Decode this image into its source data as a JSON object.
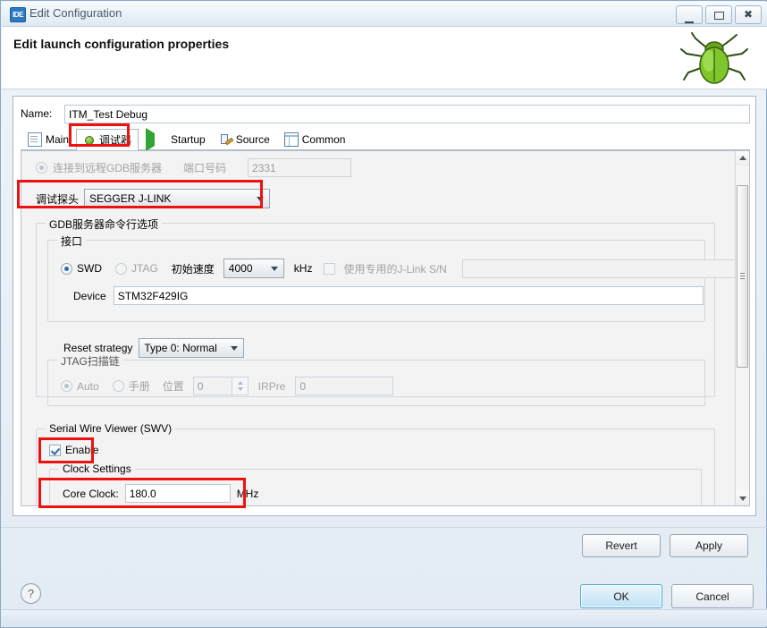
{
  "window": {
    "title": "Edit Configuration",
    "app_icon_text": "IDE",
    "minimize_label": "Minimize",
    "maximize_label": "Maximize",
    "close_label": "Close"
  },
  "header": {
    "heading": "Edit launch configuration properties",
    "icon": "green-bug-icon"
  },
  "name_field": {
    "label": "Name:",
    "value": "ITM_Test Debug"
  },
  "tabs": [
    {
      "label": "Main",
      "icon": "document-icon",
      "selected": false
    },
    {
      "label": "调试器",
      "icon": "bug-icon",
      "selected": true
    },
    {
      "label": "Startup",
      "icon": "play-icon",
      "selected": false
    },
    {
      "label": "Source",
      "icon": "source-icon",
      "selected": false
    },
    {
      "label": "Common",
      "icon": "table-icon",
      "selected": false
    }
  ],
  "debugger_tab": {
    "remote_gdb": {
      "radio_label": "连接到远程GDB服务器",
      "checked": false,
      "port_label": "端口号码",
      "port_value": "2331"
    },
    "probe": {
      "label": "调试探头",
      "value": "SEGGER J-LINK"
    },
    "gdb_server_group": {
      "caption": "GDB服务器命令行选项",
      "interface_group": {
        "caption": "接口",
        "swd_label": "SWD",
        "swd_selected": true,
        "jtag_label": "JTAG",
        "jtag_selected": false,
        "speed_label": "初始速度",
        "speed_value": "4000",
        "speed_unit": "kHz",
        "use_sn_label": "使用专用的J-Link S/N",
        "use_sn_checked": false,
        "sn_value": "",
        "device_label": "Device",
        "device_value": "STM32F429IG"
      },
      "reset_strategy_label": "Reset strategy",
      "reset_strategy_value": "Type 0: Normal",
      "jtag_scan_group": {
        "caption": "JTAG扫描链",
        "auto_label": "Auto",
        "auto_selected": true,
        "manual_label": "手册",
        "manual_selected": false,
        "position_label": "位置",
        "position_value": "0",
        "irpre_label": "IRPre",
        "irpre_value": "0"
      }
    },
    "swv_group": {
      "caption": "Serial Wire Viewer (SWV)",
      "enable_label": "Enable",
      "enable_checked": true,
      "clock_settings": {
        "caption": "Clock Settings",
        "core_clock_label": "Core Clock:",
        "core_clock_value": "180.0",
        "core_clock_unit": "MHz"
      }
    }
  },
  "buttons": {
    "revert": "Revert",
    "apply": "Apply",
    "ok": "OK",
    "cancel": "Cancel",
    "help": "?"
  },
  "highlights": {
    "accent_color": "#ee1111",
    "regions": [
      "debugger-tab",
      "debug-probe-row",
      "swv-enable-checkbox",
      "core-clock-row"
    ]
  }
}
